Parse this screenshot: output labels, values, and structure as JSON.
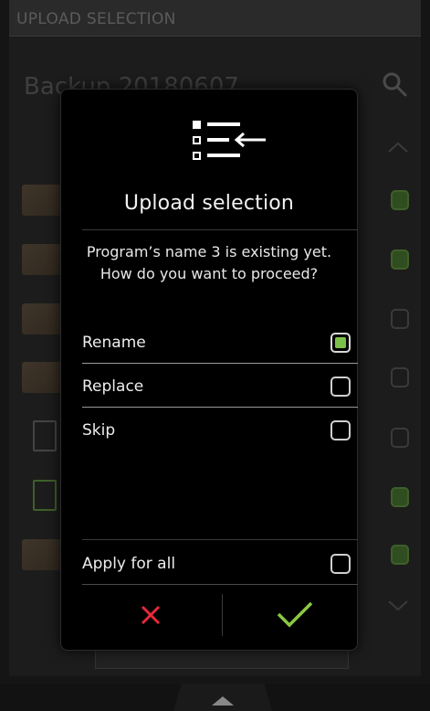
{
  "header": {
    "title": "UPLOAD SELECTION"
  },
  "background": {
    "title": "Backup 20180607"
  },
  "dialog": {
    "title": "Upload selection",
    "message_line1": "Program’s name 3 is existing yet.",
    "message_line2": "How do you want to proceed?",
    "options": [
      {
        "label": "Rename",
        "checked": true
      },
      {
        "label": "Replace",
        "checked": false
      },
      {
        "label": "Skip",
        "checked": false
      }
    ],
    "apply_all": {
      "label": "Apply for all",
      "checked": false
    },
    "icon": "upload-list-icon"
  },
  "colors": {
    "accent_green": "#7cc04c",
    "cancel_red": "#e8283c",
    "confirm_green": "#8ac843"
  }
}
